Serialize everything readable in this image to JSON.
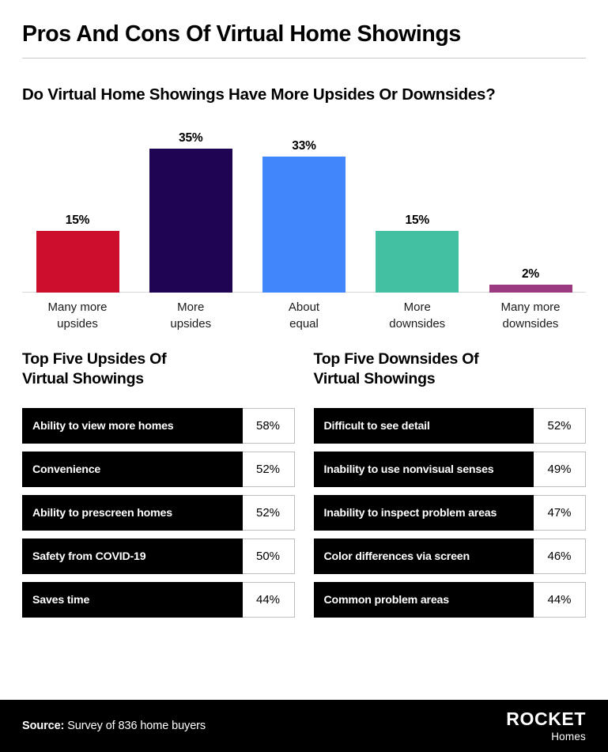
{
  "header": {
    "title": "Pros And Cons Of Virtual Home Showings"
  },
  "chart_data": {
    "type": "bar",
    "title": "Do Virtual Home Showings Have More Upsides Or Downsides?",
    "xlabel": "",
    "ylabel": "",
    "ylim": [
      0,
      38
    ],
    "grid": false,
    "legend": "none",
    "categories": [
      "Many more\nupsides",
      "More\nupsides",
      "About\nequal",
      "More\ndownsides",
      "Many more\ndownsides"
    ],
    "values": [
      15,
      35,
      33,
      15,
      2
    ],
    "value_labels": [
      "15%",
      "35%",
      "33%",
      "15%",
      "2%"
    ],
    "colors": [
      "#CE0E2D",
      "#1E0452",
      "#4286FB",
      "#42C0A1",
      "#9B3A80"
    ]
  },
  "upsides": {
    "heading": "Top Five Upsides Of\nVirtual Showings",
    "rows": [
      {
        "label": "Ability to view more homes",
        "value": "58%"
      },
      {
        "label": "Convenience",
        "value": "52%"
      },
      {
        "label": "Ability to prescreen homes",
        "value": "52%"
      },
      {
        "label": "Safety from COVID-19",
        "value": "50%"
      },
      {
        "label": "Saves time",
        "value": "44%"
      }
    ]
  },
  "downsides": {
    "heading": "Top Five Downsides Of\nVirtual Showings",
    "rows": [
      {
        "label": "Difficult to see detail",
        "value": "52%"
      },
      {
        "label": "Inability to use nonvisual senses",
        "value": "49%"
      },
      {
        "label": "Inability to inspect problem areas",
        "value": "47%"
      },
      {
        "label": "Color differences via screen",
        "value": "46%"
      },
      {
        "label": "Common problem areas",
        "value": "44%"
      }
    ]
  },
  "footer": {
    "source_label": "Source:",
    "source_text": "Survey of 836 home buyers",
    "logo_main": "ROCKET",
    "logo_sub": "Homes"
  },
  "theme": {
    "background": "#FFFFFF",
    "text": "#000000",
    "footer_background": "#000000",
    "rule": "#C9C9C9",
    "cell_border": "#BDBDBD"
  }
}
